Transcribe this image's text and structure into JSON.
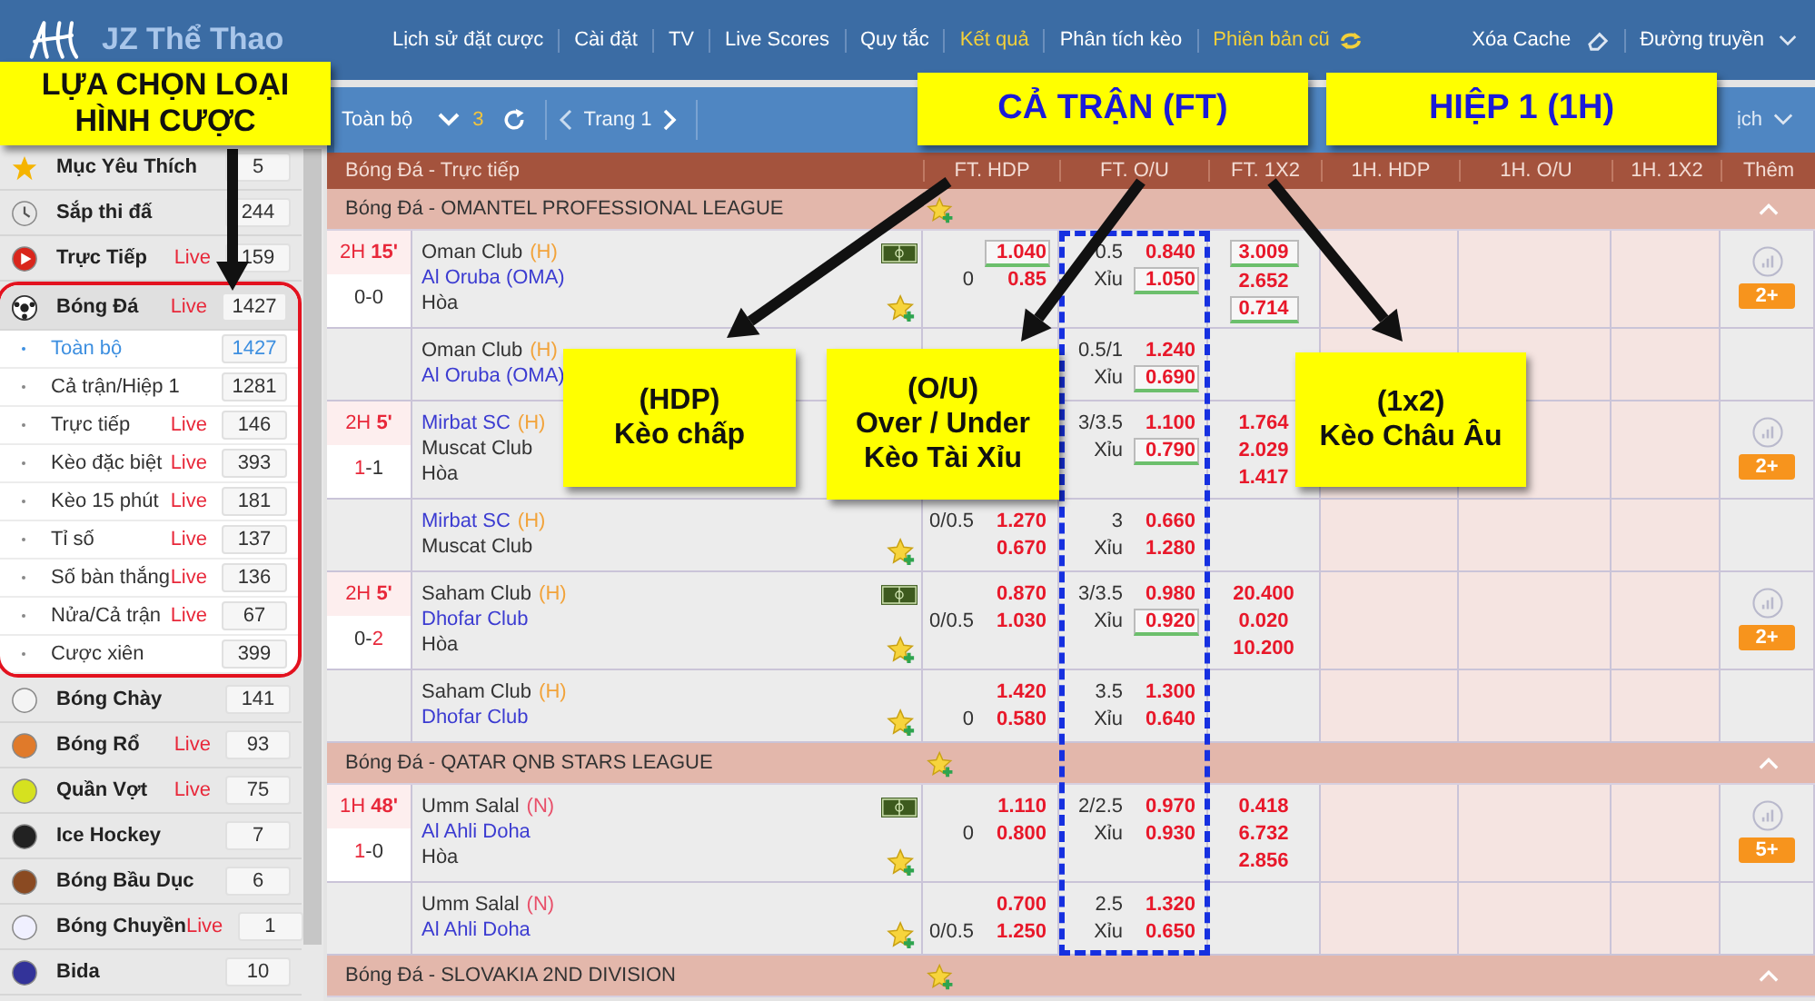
{
  "topbar": {
    "brand": "JZ Thể Thao",
    "nav": [
      {
        "label": "Lịch sử đặt cược",
        "highlighted": false
      },
      {
        "label": "Cài đặt",
        "highlighted": false
      },
      {
        "label": "TV",
        "highlighted": false
      },
      {
        "label": "Live Scores",
        "highlighted": false
      },
      {
        "label": "Quy tắc",
        "highlighted": false
      },
      {
        "label": "Kết quả",
        "highlighted": true
      },
      {
        "label": "Phân tích kèo",
        "highlighted": false
      },
      {
        "label": "Phiên bản cũ",
        "highlighted": true
      }
    ],
    "actions": [
      "Xóa Cache",
      "Đường truyền"
    ]
  },
  "toolbar": {
    "view": "Toàn bộ",
    "count": "3",
    "page": "Trang 1",
    "trailing": "ịch"
  },
  "sidebar": {
    "items": [
      {
        "label": "Mục Yêu Thích",
        "count": "5"
      },
      {
        "label": "Sắp thi đấ",
        "count": "244"
      },
      {
        "label": "Trực Tiếp",
        "badge": "Live",
        "count": "159"
      },
      {
        "label": "Bóng Đá",
        "badge": "Live",
        "count": "1427",
        "children": [
          {
            "label": "Toàn bộ",
            "count": "1427",
            "selected": true
          },
          {
            "label": "Cả trận/Hiệp 1",
            "count": "1281",
            "selected": false
          },
          {
            "label": "Trực tiếp",
            "badge": "Live",
            "count": "146",
            "selected": false
          },
          {
            "label": "Kèo đặc biệt",
            "badge": "Live",
            "count": "393",
            "selected": false
          },
          {
            "label": "Kèo 15 phút",
            "badge": "Live",
            "count": "181",
            "selected": false
          },
          {
            "label": "Tỉ số",
            "badge": "Live",
            "count": "137",
            "selected": false
          },
          {
            "label": "Số bàn thắng",
            "badge": "Live",
            "count": "136",
            "selected": false
          },
          {
            "label": "Nửa/Cả trận",
            "badge": "Live",
            "count": "67",
            "selected": false
          },
          {
            "label": "Cược xiên",
            "count": "399",
            "selected": false
          }
        ]
      },
      {
        "label": "Bóng Chày",
        "count": "141"
      },
      {
        "label": "Bóng Rổ",
        "badge": "Live",
        "count": "93"
      },
      {
        "label": "Quần Vợt",
        "badge": "Live",
        "count": "75"
      },
      {
        "label": "Ice Hockey",
        "count": "7"
      },
      {
        "label": "Bóng Bầu Dục",
        "count": "6"
      },
      {
        "label": "Bóng Chuyền",
        "badge": "Live",
        "count": "1"
      },
      {
        "label": "Bida",
        "count": "10"
      }
    ]
  },
  "table": {
    "columns": [
      "Bóng Đá - Trực tiếp",
      "FT. HDP",
      "FT. O/U",
      "FT. 1X2",
      "1H. HDP",
      "1H. O/U",
      "1H. 1X2",
      "Thêm"
    ],
    "leagues": [
      {
        "name": "Bóng Đá - OMANTEL PROFESSIONAL LEAGUE",
        "rows": [
          {
            "kind": "main",
            "time": "2H **15'**",
            "score": [
              {
                "text": "0",
                "hot": false
              },
              {
                "text": "-",
                "hot": false
              },
              {
                "text": "0",
                "hot": false
              }
            ],
            "teams": [
              {
                "name": "Oman Club",
                "tag": "(H)",
                "color": "#f2a33a",
                "favored": false
              },
              {
                "name": "Al Oruba (OMA)",
                "favored": true
              }
            ],
            "draw": "Hòa",
            "hdp": {
              "line": "0",
              "home": {
                "v": "1.040",
                "boxed": true
              },
              "away": {
                "v": "0.85",
                "boxed": false
              }
            },
            "ou": {
              "line": "0.5",
              "over": {
                "v": "0.840",
                "boxed": false
              },
              "under_label": "Xỉu",
              "under": {
                "v": "1.050",
                "boxed": true
              }
            },
            "x12": [
              {
                "v": "3.009",
                "boxed": true
              },
              {
                "v": "2.652",
                "boxed": false
              },
              {
                "v": "0.714",
                "boxed": true
              }
            ],
            "more": "2+"
          },
          {
            "kind": "sub",
            "teams": [
              {
                "name": "Oman Club",
                "tag": "(H)",
                "color": "#f2a33a",
                "favored": false
              },
              {
                "name": "Al Oruba (OMA)",
                "favored": true
              }
            ],
            "ou": {
              "line": "0.5/1",
              "over": {
                "v": "1.240",
                "boxed": false
              },
              "under_label": "Xỉu",
              "under": {
                "v": "0.690",
                "boxed": true
              }
            }
          },
          {
            "kind": "main",
            "time": "2H **5'**",
            "score": [
              {
                "text": "1",
                "hot": true
              },
              {
                "text": "-",
                "hot": false
              },
              {
                "text": "1",
                "hot": false
              }
            ],
            "teams": [
              {
                "name": "Mirbat SC",
                "tag": "(H)",
                "color": "#f2a33a",
                "favored": true
              },
              {
                "name": "Muscat Club",
                "favored": false
              }
            ],
            "draw": "Hòa",
            "ou": {
              "line": "3/3.5",
              "over": {
                "v": "1.100",
                "boxed": false
              },
              "under_label": "Xỉu",
              "under": {
                "v": "0.790",
                "boxed": true
              }
            },
            "x12": [
              {
                "v": "1.764",
                "boxed": false
              },
              {
                "v": "2.029",
                "boxed": false
              },
              {
                "v": "1.417",
                "boxed": false
              }
            ],
            "more": "2+"
          },
          {
            "kind": "sub",
            "teams": [
              {
                "name": "Mirbat SC",
                "tag": "(H)",
                "color": "#f2a33a",
                "favored": true
              },
              {
                "name": "Muscat Club",
                "favored": false
              }
            ],
            "hdp": {
              "line": "0/0.5",
              "home": {
                "v": "1.270",
                "boxed": false
              },
              "away": {
                "v": "0.670",
                "boxed": false
              }
            },
            "ou": {
              "line": "3",
              "over": {
                "v": "0.660",
                "boxed": false
              },
              "under_label": "Xỉu",
              "under": {
                "v": "1.280",
                "boxed": false
              }
            }
          },
          {
            "kind": "main",
            "time": "2H **5'**",
            "score": [
              {
                "text": "0",
                "hot": false
              },
              {
                "text": "-",
                "hot": false
              },
              {
                "text": "2",
                "hot": true
              }
            ],
            "teams": [
              {
                "name": "Saham Club",
                "tag": "(H)",
                "color": "#f2a33a",
                "favored": false
              },
              {
                "name": "Dhofar Club",
                "favored": true
              }
            ],
            "draw": "Hòa",
            "hdp": {
              "line": "0/0.5",
              "home": {
                "v": "0.870",
                "boxed": false
              },
              "away": {
                "v": "1.030",
                "boxed": false
              }
            },
            "ou": {
              "line": "3/3.5",
              "over": {
                "v": "0.980",
                "boxed": false
              },
              "under_label": "Xỉu",
              "under": {
                "v": "0.920",
                "boxed": true
              }
            },
            "x12": [
              {
                "v": "20.400",
                "boxed": false
              },
              {
                "v": "0.020",
                "boxed": false
              },
              {
                "v": "10.200",
                "boxed": false
              }
            ],
            "more": "2+"
          },
          {
            "kind": "sub",
            "teams": [
              {
                "name": "Saham Club",
                "tag": "(H)",
                "color": "#f2a33a",
                "favored": false
              },
              {
                "name": "Dhofar Club",
                "favored": true
              }
            ],
            "hdp": {
              "line": "0",
              "home": {
                "v": "1.420",
                "boxed": false
              },
              "away": {
                "v": "0.580",
                "boxed": false
              }
            },
            "ou": {
              "line": "3.5",
              "over": {
                "v": "1.300",
                "boxed": false
              },
              "under_label": "Xỉu",
              "under": {
                "v": "0.640",
                "boxed": false
              }
            }
          }
        ]
      },
      {
        "name": "Bóng Đá - QATAR QNB STARS LEAGUE",
        "rows": [
          {
            "kind": "main",
            "time": "1H **48'**",
            "score": [
              {
                "text": "1",
                "hot": true
              },
              {
                "text": "-",
                "hot": false
              },
              {
                "text": "0",
                "hot": false
              }
            ],
            "teams": [
              {
                "name": "Umm Salal",
                "tag": "(N)",
                "color": "#e8506a",
                "favored": false
              },
              {
                "name": "Al Ahli Doha",
                "favored": true
              }
            ],
            "draw": "Hòa",
            "hdp": {
              "line": "0",
              "home": {
                "v": "1.110",
                "boxed": false
              },
              "away": {
                "v": "0.800",
                "boxed": false
              }
            },
            "ou": {
              "line": "2/2.5",
              "over": {
                "v": "0.970",
                "boxed": false
              },
              "under_label": "Xỉu",
              "under": {
                "v": "0.930",
                "boxed": false
              }
            },
            "x12": [
              {
                "v": "0.418",
                "boxed": false
              },
              {
                "v": "6.732",
                "boxed": false
              },
              {
                "v": "2.856",
                "boxed": false
              }
            ],
            "more": "5+"
          },
          {
            "kind": "sub",
            "teams": [
              {
                "name": "Umm Salal",
                "tag": "(N)",
                "color": "#e8506a",
                "favored": false
              },
              {
                "name": "Al Ahli Doha",
                "favored": true
              }
            ],
            "hdp": {
              "line": "0/0.5",
              "home": {
                "v": "0.700",
                "boxed": false
              },
              "away": {
                "v": "1.250",
                "boxed": false
              }
            },
            "ou": {
              "line": "2.5",
              "over": {
                "v": "1.320",
                "boxed": false
              },
              "under_label": "Xỉu",
              "under": {
                "v": "0.650",
                "boxed": false
              }
            }
          }
        ]
      },
      {
        "name": "Bóng Đá - SLOVAKIA 2ND DIVISION"
      }
    ]
  },
  "callouts": [
    {
      "kind": "note",
      "lines": [
        "LỰA CHỌN LOẠI",
        "HÌNH CƯỢC"
      ]
    },
    {
      "kind": "column",
      "lines": [
        "CẢ TRẬN (FT)"
      ]
    },
    {
      "kind": "column",
      "lines": [
        "HIỆP 1 (1H)"
      ]
    },
    {
      "kind": "note",
      "lines": [
        "(HDP)",
        "Kèo chấp"
      ]
    },
    {
      "kind": "note",
      "lines": [
        "(O/U)",
        "Over / Under",
        "Kèo Tài Xỉu"
      ]
    },
    {
      "kind": "note",
      "lines": [
        "(1x2)",
        "Kèo Châu Âu"
      ]
    }
  ]
}
